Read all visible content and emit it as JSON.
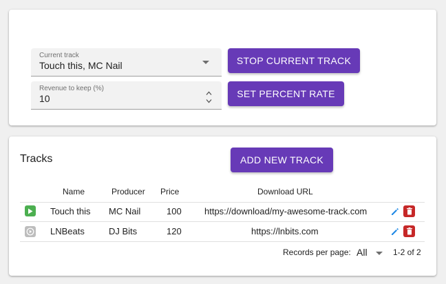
{
  "player": {
    "current_track_label": "Current track",
    "current_track_value": "Touch this, MC Nail",
    "revenue_label": "Revenue to keep (%)",
    "revenue_value": "10",
    "stop_button": "STOP CURRENT TRACK",
    "rate_button": "SET PERCENT RATE"
  },
  "tracks": {
    "title": "Tracks",
    "add_button": "ADD NEW TRACK",
    "columns": [
      "Name",
      "Producer",
      "Price",
      "Download URL"
    ],
    "rows": [
      {
        "name": "Touch this",
        "producer": "MC Nail",
        "price": "100",
        "url": "https://download/my-awesome-track.com",
        "playing": true,
        "play_icon": "play-icon"
      },
      {
        "name": "LNBeats",
        "producer": "DJ Bits",
        "price": "120",
        "url": "https://lnbits.com",
        "playing": false,
        "play_icon": "play-circle-icon"
      }
    ],
    "records_per_page_label": "Records per page:",
    "records_per_page_value": "All",
    "pagination": "1-2 of 2"
  },
  "colors": {
    "accent": "#673ab7",
    "play_active": "#4caf50",
    "play_inactive": "#bdbdbd",
    "edit": "#1e88e5",
    "delete": "#c62828"
  }
}
